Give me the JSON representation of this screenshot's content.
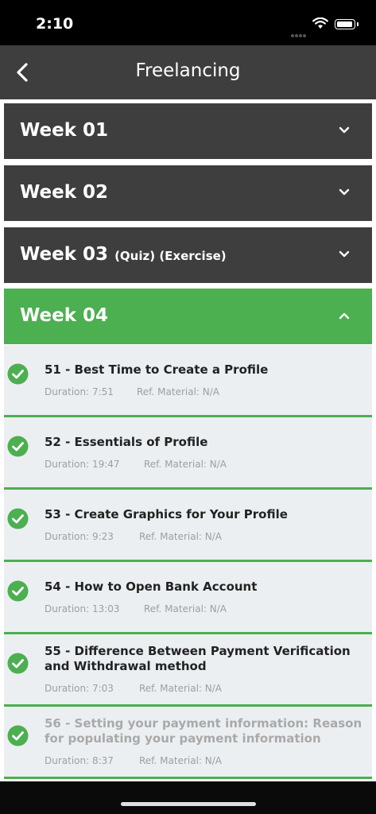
{
  "status": {
    "time": "2:10"
  },
  "nav": {
    "title": "Freelancing"
  },
  "weeks": [
    {
      "label": "Week 01",
      "tags": "",
      "expanded": false
    },
    {
      "label": "Week 02",
      "tags": "",
      "expanded": false
    },
    {
      "label": "Week 03",
      "tags": "(Quiz) (Exercise)",
      "expanded": false
    },
    {
      "label": "Week 04",
      "tags": "",
      "expanded": true
    }
  ],
  "lessons": [
    {
      "title": "51 - Best Time to Create a Profile",
      "duration": "Duration: 7:51",
      "ref": "Ref. Material: N/A",
      "completed": true
    },
    {
      "title": "52 - Essentials of Profile",
      "duration": "Duration: 19:47",
      "ref": "Ref. Material: N/A",
      "completed": true
    },
    {
      "title": "53 - Create Graphics for Your Profile",
      "duration": "Duration: 9:23",
      "ref": "Ref. Material: N/A",
      "completed": true
    },
    {
      "title": "54 - How to Open Bank Account",
      "duration": "Duration: 13:03",
      "ref": "Ref. Material: N/A",
      "completed": true
    },
    {
      "title": "55 - Difference Between Payment Verification and Withdrawal method",
      "duration": "Duration: 7:03",
      "ref": "Ref. Material: N/A",
      "completed": true
    },
    {
      "title": "56 - Setting your payment information: Reason for populating your payment information",
      "duration": "Duration: 8:37",
      "ref": "Ref. Material: N/A",
      "completed": true
    }
  ],
  "colors": {
    "accent": "#4caf50",
    "header": "#3e3e3e",
    "lesson_bg": "#eceff1"
  }
}
